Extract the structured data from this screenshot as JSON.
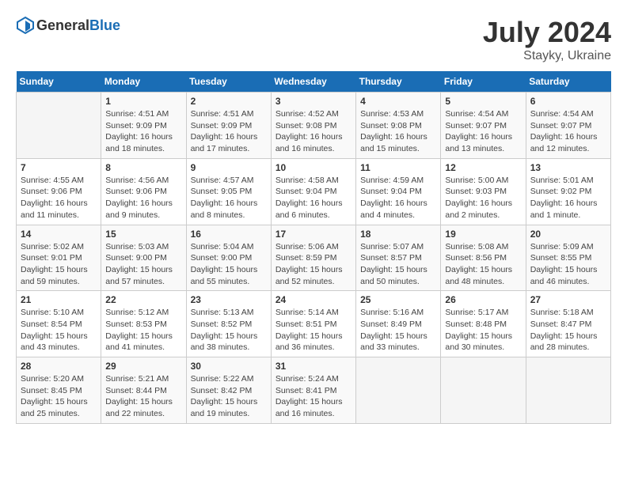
{
  "header": {
    "logo_general": "General",
    "logo_blue": "Blue",
    "month_year": "July 2024",
    "location": "Stayky, Ukraine"
  },
  "weekdays": [
    "Sunday",
    "Monday",
    "Tuesday",
    "Wednesday",
    "Thursday",
    "Friday",
    "Saturday"
  ],
  "weeks": [
    [
      {
        "day": "",
        "info": ""
      },
      {
        "day": "1",
        "info": "Sunrise: 4:51 AM\nSunset: 9:09 PM\nDaylight: 16 hours\nand 18 minutes."
      },
      {
        "day": "2",
        "info": "Sunrise: 4:51 AM\nSunset: 9:09 PM\nDaylight: 16 hours\nand 17 minutes."
      },
      {
        "day": "3",
        "info": "Sunrise: 4:52 AM\nSunset: 9:08 PM\nDaylight: 16 hours\nand 16 minutes."
      },
      {
        "day": "4",
        "info": "Sunrise: 4:53 AM\nSunset: 9:08 PM\nDaylight: 16 hours\nand 15 minutes."
      },
      {
        "day": "5",
        "info": "Sunrise: 4:54 AM\nSunset: 9:07 PM\nDaylight: 16 hours\nand 13 minutes."
      },
      {
        "day": "6",
        "info": "Sunrise: 4:54 AM\nSunset: 9:07 PM\nDaylight: 16 hours\nand 12 minutes."
      }
    ],
    [
      {
        "day": "7",
        "info": "Sunrise: 4:55 AM\nSunset: 9:06 PM\nDaylight: 16 hours\nand 11 minutes."
      },
      {
        "day": "8",
        "info": "Sunrise: 4:56 AM\nSunset: 9:06 PM\nDaylight: 16 hours\nand 9 minutes."
      },
      {
        "day": "9",
        "info": "Sunrise: 4:57 AM\nSunset: 9:05 PM\nDaylight: 16 hours\nand 8 minutes."
      },
      {
        "day": "10",
        "info": "Sunrise: 4:58 AM\nSunset: 9:04 PM\nDaylight: 16 hours\nand 6 minutes."
      },
      {
        "day": "11",
        "info": "Sunrise: 4:59 AM\nSunset: 9:04 PM\nDaylight: 16 hours\nand 4 minutes."
      },
      {
        "day": "12",
        "info": "Sunrise: 5:00 AM\nSunset: 9:03 PM\nDaylight: 16 hours\nand 2 minutes."
      },
      {
        "day": "13",
        "info": "Sunrise: 5:01 AM\nSunset: 9:02 PM\nDaylight: 16 hours\nand 1 minute."
      }
    ],
    [
      {
        "day": "14",
        "info": "Sunrise: 5:02 AM\nSunset: 9:01 PM\nDaylight: 15 hours\nand 59 minutes."
      },
      {
        "day": "15",
        "info": "Sunrise: 5:03 AM\nSunset: 9:00 PM\nDaylight: 15 hours\nand 57 minutes."
      },
      {
        "day": "16",
        "info": "Sunrise: 5:04 AM\nSunset: 9:00 PM\nDaylight: 15 hours\nand 55 minutes."
      },
      {
        "day": "17",
        "info": "Sunrise: 5:06 AM\nSunset: 8:59 PM\nDaylight: 15 hours\nand 52 minutes."
      },
      {
        "day": "18",
        "info": "Sunrise: 5:07 AM\nSunset: 8:57 PM\nDaylight: 15 hours\nand 50 minutes."
      },
      {
        "day": "19",
        "info": "Sunrise: 5:08 AM\nSunset: 8:56 PM\nDaylight: 15 hours\nand 48 minutes."
      },
      {
        "day": "20",
        "info": "Sunrise: 5:09 AM\nSunset: 8:55 PM\nDaylight: 15 hours\nand 46 minutes."
      }
    ],
    [
      {
        "day": "21",
        "info": "Sunrise: 5:10 AM\nSunset: 8:54 PM\nDaylight: 15 hours\nand 43 minutes."
      },
      {
        "day": "22",
        "info": "Sunrise: 5:12 AM\nSunset: 8:53 PM\nDaylight: 15 hours\nand 41 minutes."
      },
      {
        "day": "23",
        "info": "Sunrise: 5:13 AM\nSunset: 8:52 PM\nDaylight: 15 hours\nand 38 minutes."
      },
      {
        "day": "24",
        "info": "Sunrise: 5:14 AM\nSunset: 8:51 PM\nDaylight: 15 hours\nand 36 minutes."
      },
      {
        "day": "25",
        "info": "Sunrise: 5:16 AM\nSunset: 8:49 PM\nDaylight: 15 hours\nand 33 minutes."
      },
      {
        "day": "26",
        "info": "Sunrise: 5:17 AM\nSunset: 8:48 PM\nDaylight: 15 hours\nand 30 minutes."
      },
      {
        "day": "27",
        "info": "Sunrise: 5:18 AM\nSunset: 8:47 PM\nDaylight: 15 hours\nand 28 minutes."
      }
    ],
    [
      {
        "day": "28",
        "info": "Sunrise: 5:20 AM\nSunset: 8:45 PM\nDaylight: 15 hours\nand 25 minutes."
      },
      {
        "day": "29",
        "info": "Sunrise: 5:21 AM\nSunset: 8:44 PM\nDaylight: 15 hours\nand 22 minutes."
      },
      {
        "day": "30",
        "info": "Sunrise: 5:22 AM\nSunset: 8:42 PM\nDaylight: 15 hours\nand 19 minutes."
      },
      {
        "day": "31",
        "info": "Sunrise: 5:24 AM\nSunset: 8:41 PM\nDaylight: 15 hours\nand 16 minutes."
      },
      {
        "day": "",
        "info": ""
      },
      {
        "day": "",
        "info": ""
      },
      {
        "day": "",
        "info": ""
      }
    ]
  ]
}
